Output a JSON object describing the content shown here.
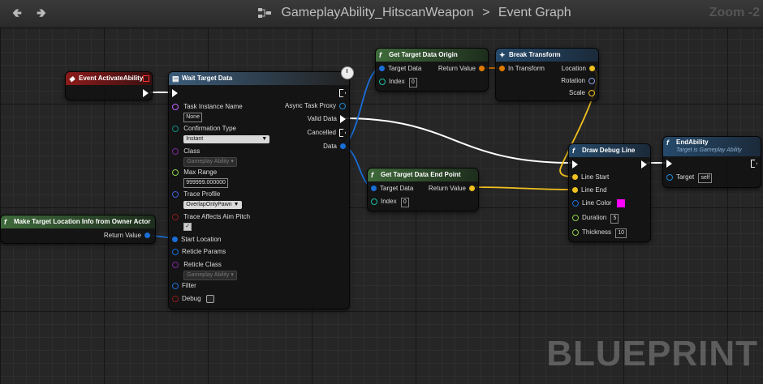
{
  "topbar": {
    "back_icon": "back-arrow-icon",
    "forward_icon": "forward-arrow-icon",
    "graph_icon": "event-graph-icon",
    "blueprint_name": "GameplayAbility_HitscanWeapon",
    "separator": ">",
    "graph_name": "Event Graph",
    "zoom": "Zoom -2"
  },
  "watermark": "BLUEPRINT",
  "nodes": {
    "event_activate": {
      "title": "Event ActivateAbility"
    },
    "make_target_location": {
      "title": "Make Target Location Info from Owner Actor",
      "return_value": "Return Value"
    },
    "wait_target_data": {
      "title": "Wait Target Data",
      "task_instance_name": "Task Instance Name",
      "task_instance_value": "None",
      "confirmation_type": "Confirmation Type",
      "confirmation_value": "Instant",
      "class": "Class",
      "class_value": "Gameplay Ability",
      "max_range": "Max Range",
      "max_range_value": "999999.000000",
      "trace_profile": "Trace Profile",
      "trace_profile_value": "OverlapOnlyPawn",
      "trace_affects_aim_pitch": "Trace Affects Aim Pitch",
      "start_location": "Start Location",
      "reticle_params": "Reticle Params",
      "reticle_class": "Reticle Class",
      "reticle_class_value": "Gameplay Ability",
      "filter": "Filter",
      "debug": "Debug",
      "async_task_proxy": "Async Task Proxy",
      "valid_data": "Valid Data",
      "cancelled": "Cancelled",
      "data": "Data"
    },
    "get_target_origin": {
      "title": "Get Target Data Origin",
      "target_data": "Target Data",
      "return_value": "Return Value",
      "index": "Index",
      "index_value": "0"
    },
    "break_transform": {
      "title": "Break Transform",
      "in_transform": "In Transform",
      "location": "Location",
      "rotation": "Rotation",
      "scale": "Scale"
    },
    "get_target_end": {
      "title": "Get Target Data End Point",
      "target_data": "Target Data",
      "return_value": "Return Value",
      "index": "Index",
      "index_value": "0"
    },
    "draw_debug_line": {
      "title": "Draw Debug Line",
      "line_start": "Line Start",
      "line_end": "Line End",
      "line_color": "Line Color",
      "duration": "Duration",
      "duration_value": "5",
      "thickness": "Thickness",
      "thickness_value": "10"
    },
    "end_ability": {
      "title": "EndAbility",
      "subtitle": "Target is Gameplay Ability",
      "target": "Target",
      "target_value": "self"
    }
  },
  "colors": {
    "exec_wire": "#ffffff",
    "vector_wire": "#f0c020",
    "struct_wire": "#1a6ed8",
    "transform_wire": "#e07b00",
    "line_color_swatch": "#ff00ff"
  }
}
